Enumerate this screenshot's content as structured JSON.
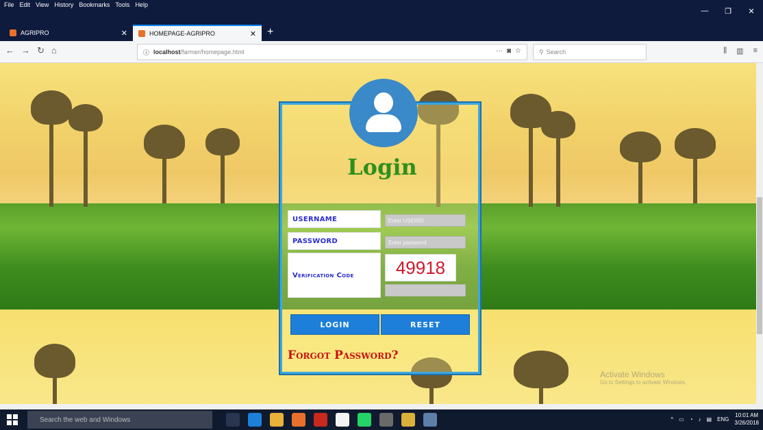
{
  "browser": {
    "menu": [
      "File",
      "Edit",
      "View",
      "History",
      "Bookmarks",
      "Tools",
      "Help"
    ],
    "tabs": [
      {
        "title": "AGRIPRO",
        "active": false
      },
      {
        "title": "HOMEPAGE-AGRIPRO",
        "active": true
      }
    ],
    "url_host": "localhost",
    "url_path": "/farmer/homepage.html",
    "search_placeholder": "Search",
    "url_extras": "···"
  },
  "login": {
    "title": "Login",
    "username_label": "USERNAME",
    "username_placeholder": "Enter USERID",
    "password_label": "PASSWORD",
    "password_placeholder": "Enter password",
    "verification_label": "Verification Code",
    "captcha_code": "49918",
    "login_button": "LOGIN",
    "reset_button": "RESET",
    "forgot_password": "Forgot Password?"
  },
  "watermark": {
    "title": "Activate Windows",
    "subtitle": "Go to Settings to activate Windows."
  },
  "taskbar": {
    "search_placeholder": "Search the web and Windows",
    "language": "ENG",
    "time": "10:01 AM",
    "date": "3/26/2018"
  },
  "colors": {
    "card_border": "#3ea7e0",
    "login_title": "#2f8f1c",
    "button_bg": "#1d7fd9",
    "forgot": "#c81010",
    "captcha": "#d0172a",
    "label_text": "#2b2bd0"
  }
}
